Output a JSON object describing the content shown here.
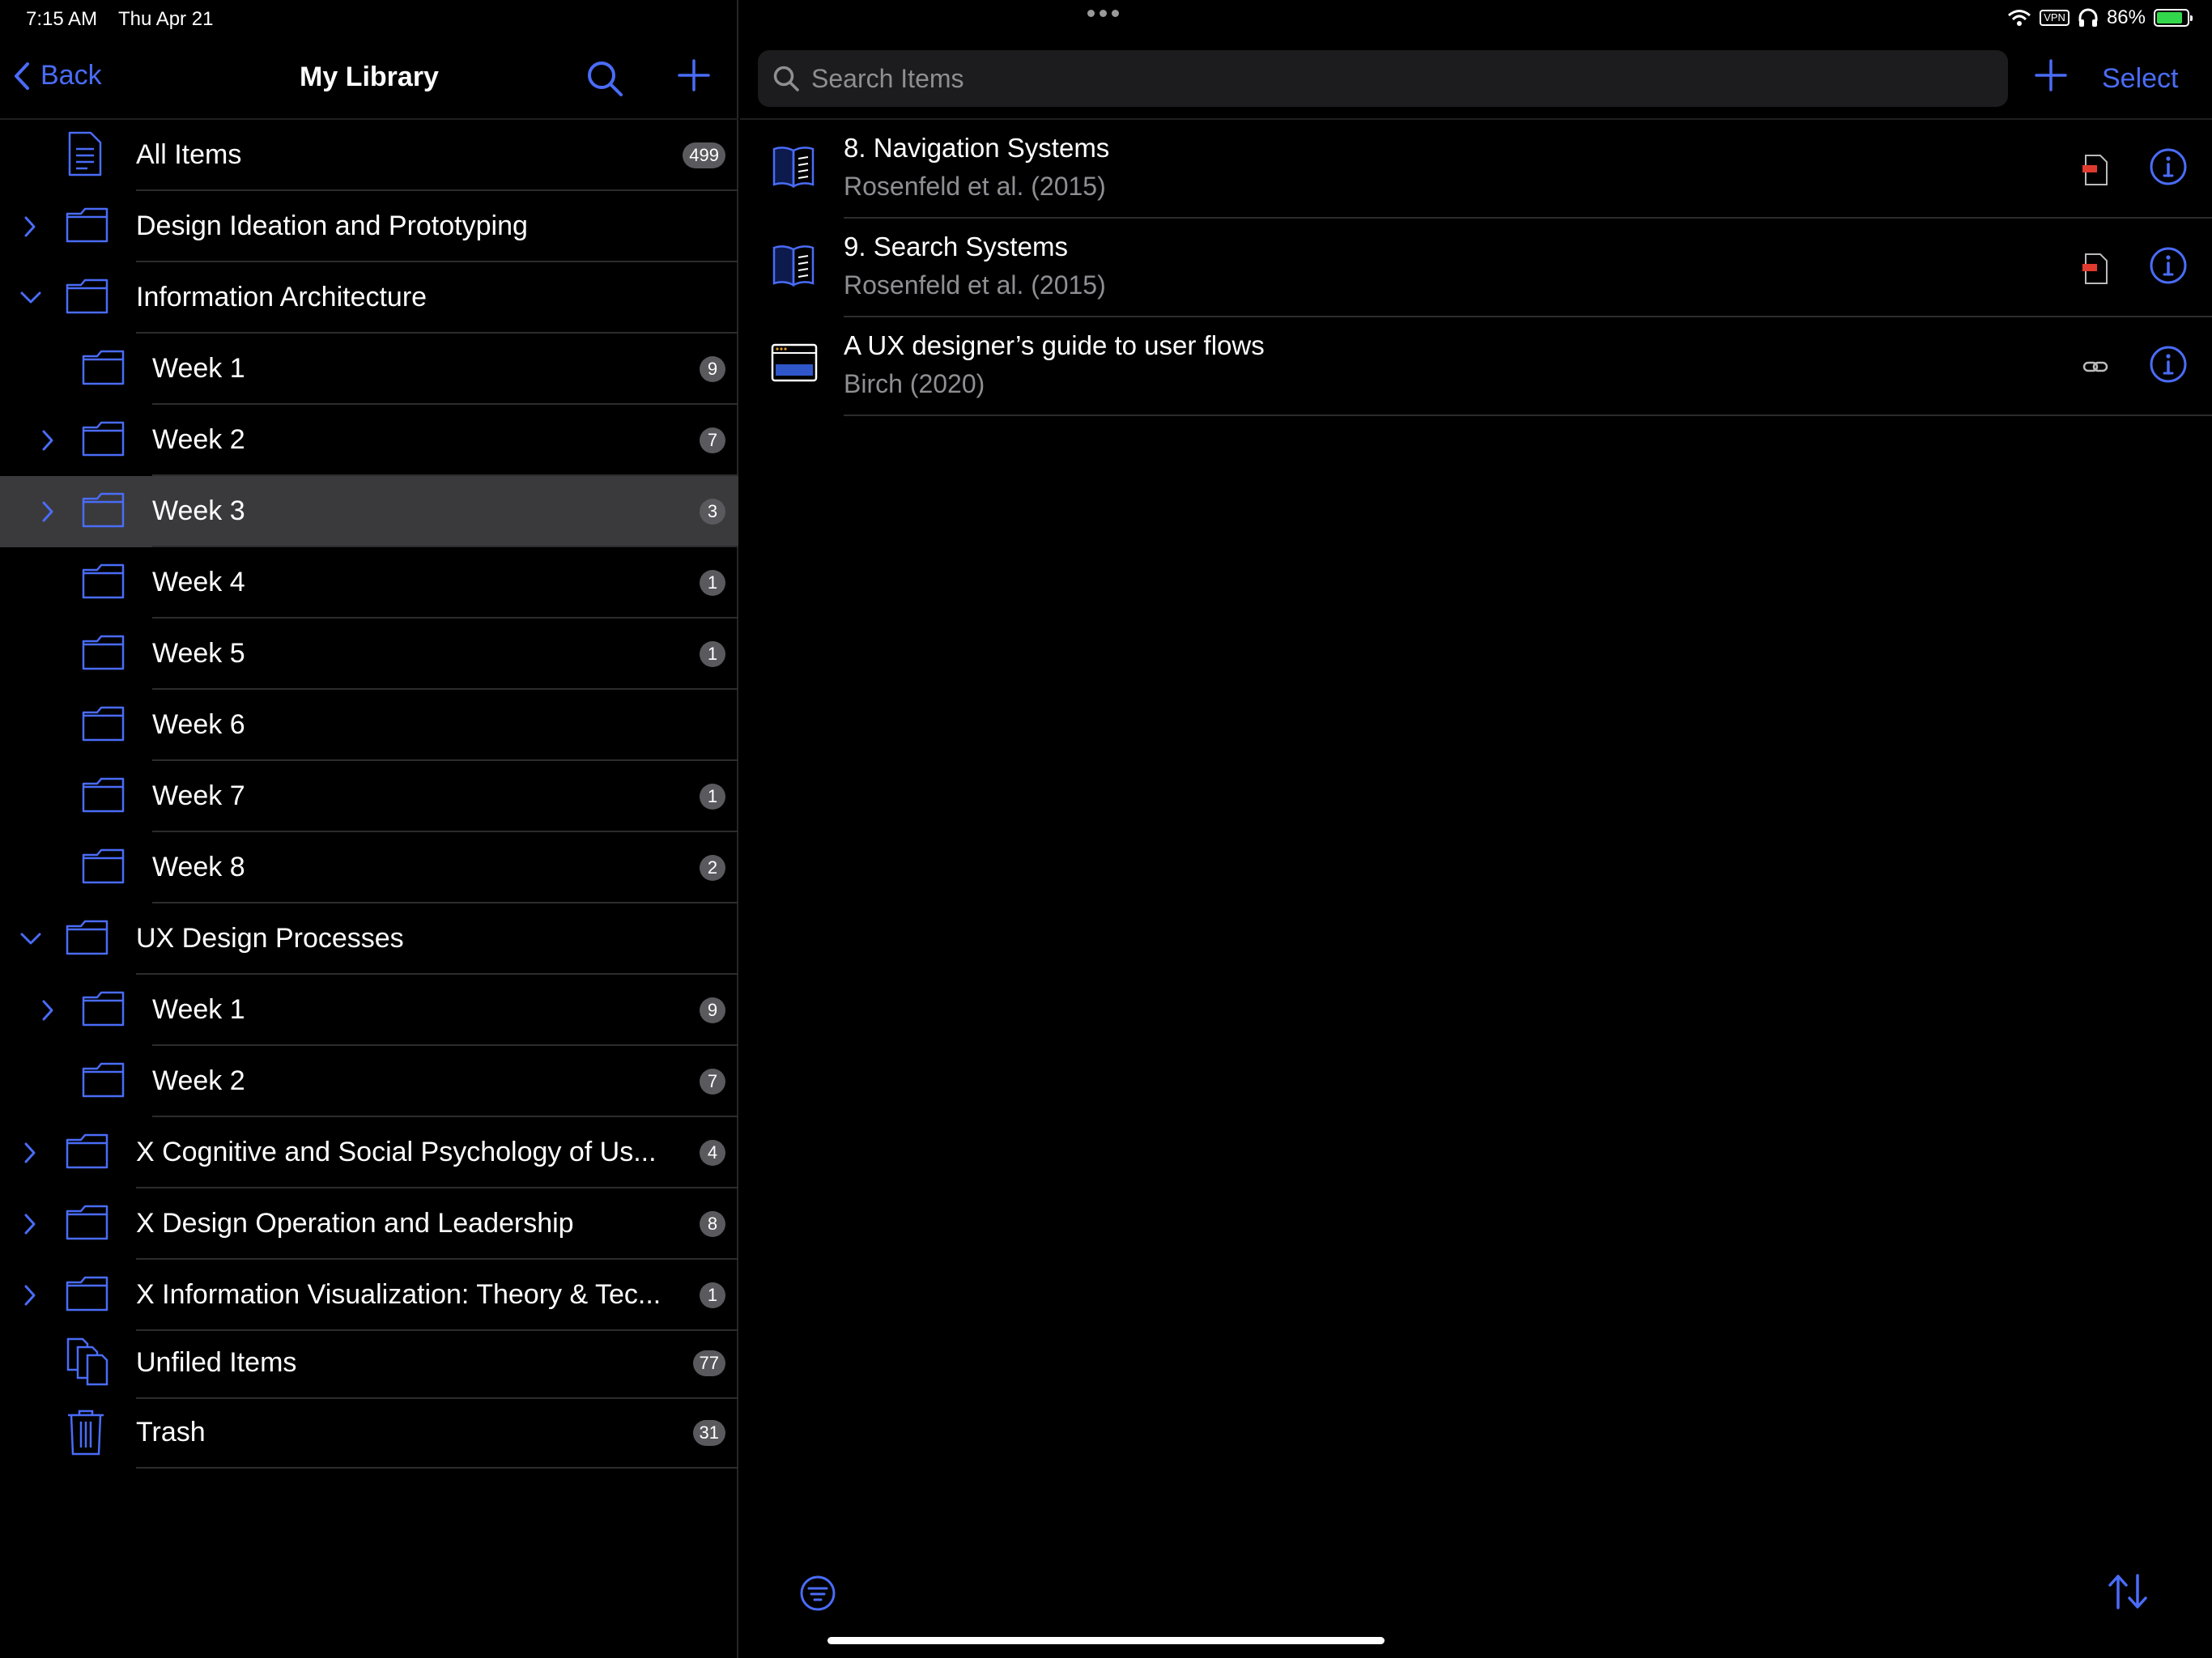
{
  "status_bar": {
    "time": "7:15 AM",
    "date": "Thu Apr 21",
    "vpn": "VPN",
    "battery": "86%",
    "battery_level": 0.86
  },
  "sidebar": {
    "back_label": "Back",
    "title": "My Library",
    "rows": [
      {
        "label": "All Items",
        "count": "499"
      },
      {
        "label": "Design Ideation and Prototyping",
        "count": ""
      },
      {
        "label": "Information Architecture",
        "count": ""
      },
      {
        "label": "Week 1",
        "count": "9"
      },
      {
        "label": "Week 2",
        "count": "7"
      },
      {
        "label": "Week 3",
        "count": "3"
      },
      {
        "label": "Week 4",
        "count": "1"
      },
      {
        "label": "Week 5",
        "count": "1"
      },
      {
        "label": "Week 6",
        "count": ""
      },
      {
        "label": "Week 7",
        "count": "1"
      },
      {
        "label": "Week 8",
        "count": "2"
      },
      {
        "label": "UX Design Processes",
        "count": ""
      },
      {
        "label": "Week 1",
        "count": "9"
      },
      {
        "label": "Week 2",
        "count": "7"
      },
      {
        "label": "X Cognitive and Social Psychology of Us...",
        "count": "4"
      },
      {
        "label": "X Design Operation and Leadership",
        "count": "8"
      },
      {
        "label": "X Information Visualization: Theory & Tec...",
        "count": "1"
      },
      {
        "label": "Unfiled Items",
        "count": "77"
      },
      {
        "label": "Trash",
        "count": "31"
      }
    ]
  },
  "main": {
    "search_placeholder": "Search Items",
    "select_label": "Select",
    "items": [
      {
        "title": "8. Navigation Systems",
        "subtitle": "Rosenfeld et al. (2015)",
        "type_icon": "book-section-icon",
        "attachment_icon": "pdf-icon"
      },
      {
        "title": "9. Search Systems",
        "subtitle": "Rosenfeld et al. (2015)",
        "type_icon": "book-section-icon",
        "attachment_icon": "pdf-icon"
      },
      {
        "title": "A UX designer’s guide to user flows",
        "subtitle": "Birch (2020)",
        "type_icon": "web-page-icon",
        "attachment_icon": "link-icon"
      }
    ]
  },
  "colors": {
    "accent": "#4a6cf7",
    "selected_row": "#3a3a3c",
    "badge": "#5a5a5e",
    "secondary_text": "#8e8e93",
    "battery_fill": "#32d74b"
  }
}
